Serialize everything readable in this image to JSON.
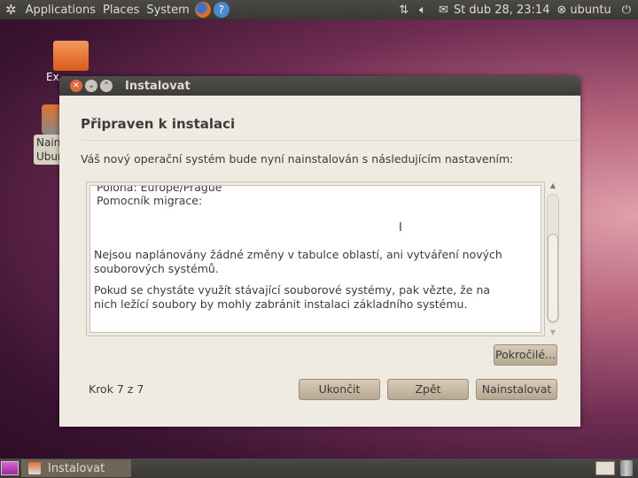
{
  "topbar": {
    "menus": [
      "Applications",
      "Places",
      "System"
    ],
    "clock": "St dub 28, 23:14",
    "user": "ubuntu"
  },
  "desktop": {
    "icon1_label": "Ex",
    "icon2_label_line1": "Nain",
    "icon2_label_line2": "Ubun"
  },
  "dialog": {
    "title": "Instalovat",
    "heading": "Připraven k instalaci",
    "intro": "Váš nový operační systém bude nyní nainstalován s následujícím nastavením:",
    "summary_lines": [
      "Polohа: Europe/Prague",
      "Pomocník migrace:"
    ],
    "paragraph1": "Nejsou naplánovány žádné změny v tabulce oblastí, ani vytváření nových souborových systémů.",
    "paragraph2": "Pokud se chystáte využít stávající souborové systémy, pak vězte, že na nich ležící soubory by mohly zabránit instalaci základního systému.",
    "advanced_button": "Pokročilé...",
    "step": "Krok 7 z 7",
    "quit_button": "Ukončit",
    "back_button": "Zpět",
    "install_button": "Nainstalovat"
  },
  "taskbar": {
    "window_button": "Instalovat"
  }
}
